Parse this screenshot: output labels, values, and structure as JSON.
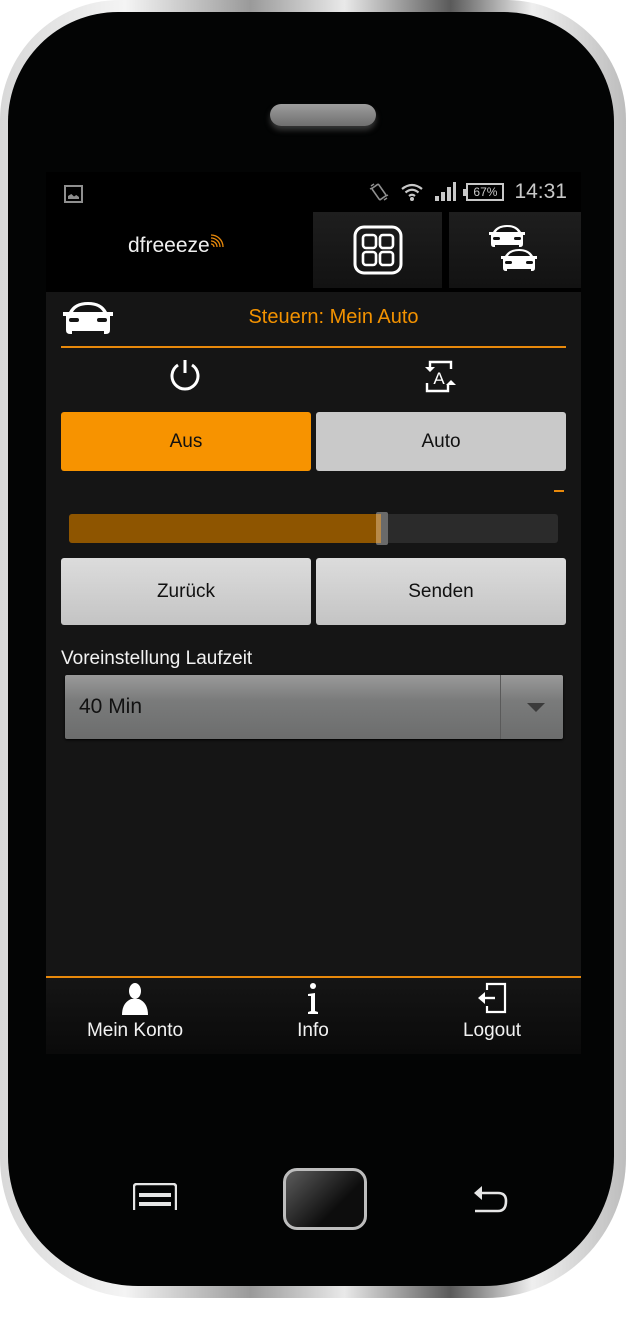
{
  "status_bar": {
    "notification_icon": "image-icon",
    "icons": [
      "vibrate-icon",
      "wifi-icon",
      "signal-icon"
    ],
    "battery": "67%",
    "time": "14:31"
  },
  "app_bar": {
    "logo": "dfreeeze",
    "buttons": [
      {
        "name": "dashboard",
        "icon": "grid-icon"
      },
      {
        "name": "vehicles",
        "icon": "two-cars-icon"
      }
    ]
  },
  "control": {
    "title": "Steuern: Mein Auto",
    "car_icon": "car-icon",
    "modes": [
      {
        "label": "Aus",
        "icon": "power-icon",
        "active": true
      },
      {
        "label": "Auto",
        "icon": "auto-mode-icon",
        "active": false
      }
    ],
    "value_text": "--",
    "slider_fraction": 0.64,
    "back_label": "Zurück",
    "send_label": "Senden",
    "preset_label": "Voreinstellung Laufzeit",
    "preset_value": "40 Min"
  },
  "bottom_nav": [
    {
      "label": "Mein Konto",
      "icon": "user-icon"
    },
    {
      "label": "Info",
      "icon": "info-icon"
    },
    {
      "label": "Logout",
      "icon": "logout-icon"
    }
  ],
  "colors": {
    "accent": "#f39200",
    "active_button": "#f79300",
    "inactive_button": "#c9c9c9",
    "background": "#151515"
  }
}
